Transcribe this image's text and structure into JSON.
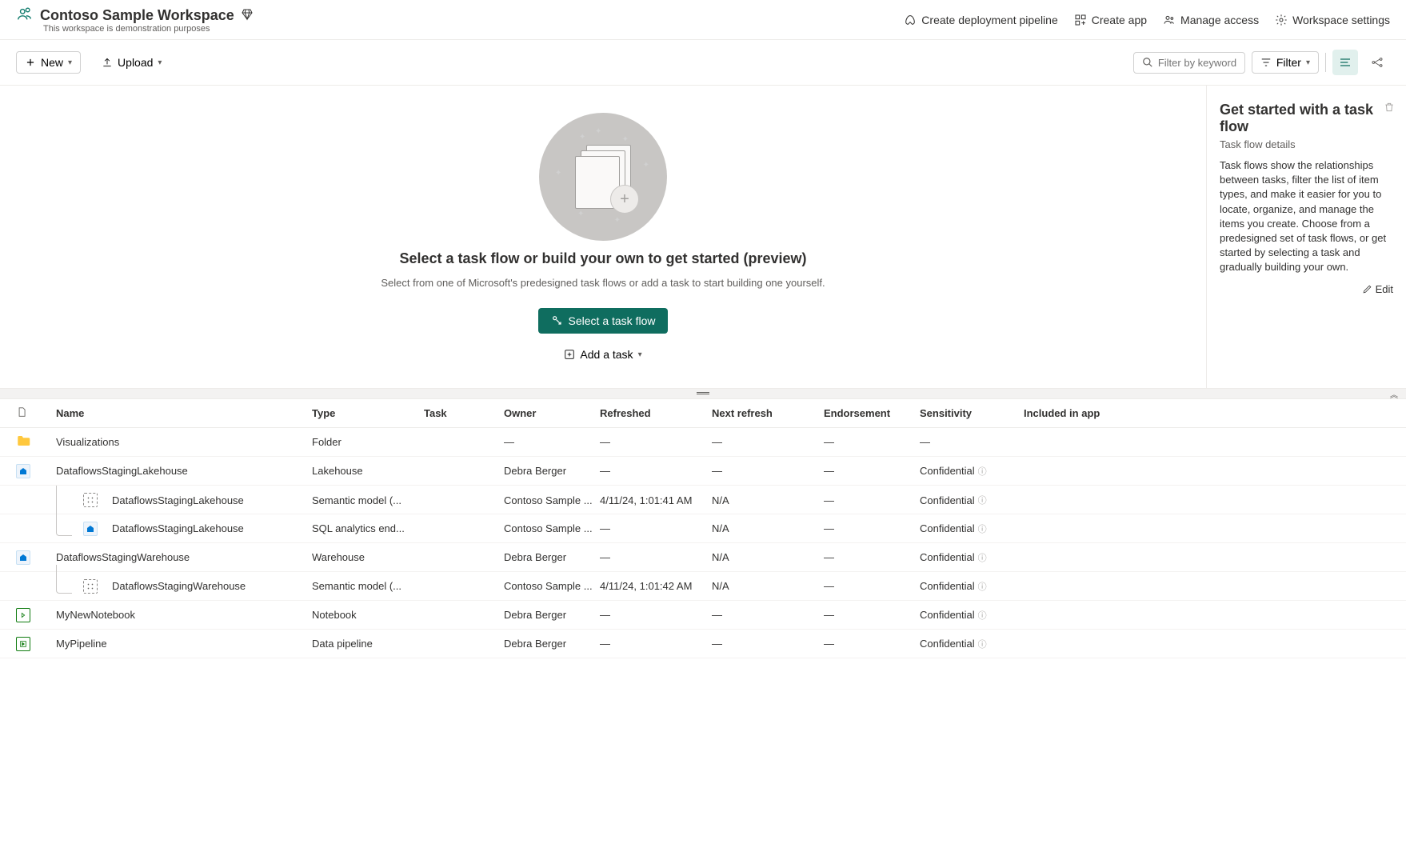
{
  "header": {
    "workspace_name": "Contoso Sample Workspace",
    "workspace_subtitle": "This workspace is demonstration purposes",
    "actions": {
      "pipeline": "Create deployment pipeline",
      "app": "Create app",
      "access": "Manage access",
      "settings": "Workspace settings"
    }
  },
  "toolbar": {
    "new_label": "New",
    "upload_label": "Upload",
    "filter_placeholder": "Filter by keyword",
    "filter_button": "Filter"
  },
  "taskflow": {
    "heading": "Select a task flow or build your own to get started (preview)",
    "subtext": "Select from one of Microsoft's predesigned task flows or add a task to start building one yourself.",
    "select_button": "Select a task flow",
    "add_button": "Add a task"
  },
  "side_panel": {
    "title": "Get started with a task flow",
    "subtitle": "Task flow details",
    "description": "Task flows show the relationships between tasks, filter the list of item types, and make it easier for you to locate, organize, and manage the items you create. Choose from a predesigned set of task flows, or get started by selecting a task and gradually building your own.",
    "edit_label": "Edit"
  },
  "table": {
    "columns": {
      "name": "Name",
      "type": "Type",
      "task": "Task",
      "owner": "Owner",
      "refreshed": "Refreshed",
      "next_refresh": "Next refresh",
      "endorsement": "Endorsement",
      "sensitivity": "Sensitivity",
      "included": "Included in app"
    },
    "rows": [
      {
        "indent": 0,
        "icon": "folder",
        "name": "Visualizations",
        "type": "Folder",
        "task": "",
        "owner": "—",
        "refreshed": "—",
        "next_refresh": "—",
        "endorsement": "—",
        "sensitivity": "—",
        "has_info": false
      },
      {
        "indent": 0,
        "icon": "lakehouse",
        "name": "DataflowsStagingLakehouse",
        "type": "Lakehouse",
        "task": "",
        "owner": "Debra Berger",
        "refreshed": "—",
        "next_refresh": "—",
        "endorsement": "—",
        "sensitivity": "Confidential",
        "has_info": true
      },
      {
        "indent": 1,
        "connector": "line",
        "icon": "model",
        "name": "DataflowsStagingLakehouse",
        "type": "Semantic model (...",
        "task": "",
        "owner": "Contoso Sample ...",
        "refreshed": "4/11/24, 1:01:41 AM",
        "next_refresh": "N/A",
        "endorsement": "—",
        "sensitivity": "Confidential",
        "has_info": true
      },
      {
        "indent": 1,
        "connector": "end",
        "icon": "sql",
        "name": "DataflowsStagingLakehouse",
        "type": "SQL analytics end...",
        "task": "",
        "owner": "Contoso Sample ...",
        "refreshed": "—",
        "next_refresh": "N/A",
        "endorsement": "—",
        "sensitivity": "Confidential",
        "has_info": true
      },
      {
        "indent": 0,
        "icon": "warehouse",
        "name": "DataflowsStagingWarehouse",
        "type": "Warehouse",
        "task": "",
        "owner": "Debra Berger",
        "refreshed": "—",
        "next_refresh": "N/A",
        "endorsement": "—",
        "sensitivity": "Confidential",
        "has_info": true
      },
      {
        "indent": 1,
        "connector": "end",
        "icon": "model",
        "name": "DataflowsStagingWarehouse",
        "type": "Semantic model (...",
        "task": "",
        "owner": "Contoso Sample ...",
        "refreshed": "4/11/24, 1:01:42 AM",
        "next_refresh": "N/A",
        "endorsement": "—",
        "sensitivity": "Confidential",
        "has_info": true
      },
      {
        "indent": 0,
        "icon": "notebook",
        "name": "MyNewNotebook",
        "type": "Notebook",
        "task": "",
        "owner": "Debra Berger",
        "refreshed": "—",
        "next_refresh": "—",
        "endorsement": "—",
        "sensitivity": "Confidential",
        "has_info": true
      },
      {
        "indent": 0,
        "icon": "pipeline",
        "name": "MyPipeline",
        "type": "Data pipeline",
        "task": "",
        "owner": "Debra Berger",
        "refreshed": "—",
        "next_refresh": "—",
        "endorsement": "—",
        "sensitivity": "Confidential",
        "has_info": true
      }
    ]
  }
}
